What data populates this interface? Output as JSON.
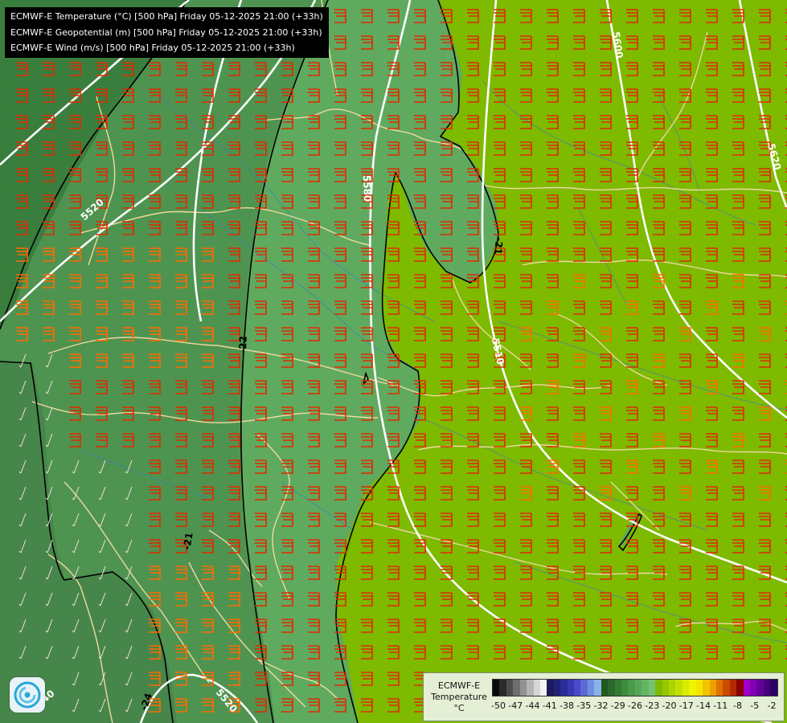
{
  "header": {
    "line1": "ECMWF-E Temperature (°C) [500 hPa] Friday 05-12-2025 21:00 (+33h)",
    "line2": "ECMWF-E Geopotential (m) [500 hPa] Friday 05-12-2025 21:00 (+33h)",
    "line3": "ECMWF-E Wind (m/s) [500 hPa] Friday 05-12-2025 21:00 (+33h)"
  },
  "legend": {
    "line1": "ECMWF-E",
    "line2": "Temperature",
    "unit": "°C",
    "colors": [
      "#0a0a0a",
      "#2b2b2b",
      "#4d4d4d",
      "#6f6f6f",
      "#929292",
      "#b4b4b4",
      "#d6d6d6",
      "#f2f2f2",
      "#1a1a5c",
      "#22227a",
      "#2c2c98",
      "#3838b2",
      "#4a4ac8",
      "#5a6ad6",
      "#6f8ee0",
      "#8ab4ea",
      "#1f5a1f",
      "#2a6a2a",
      "#347a34",
      "#3e8a3e",
      "#4a9a4a",
      "#56a856",
      "#63b563",
      "#72c272",
      "#7fba00",
      "#95c800",
      "#abd400",
      "#c2e000",
      "#d8ec00",
      "#eef500",
      "#f7e400",
      "#f2c400",
      "#ec9e00",
      "#e07000",
      "#cc4a00",
      "#b42a00",
      "#8c0000",
      "#a000c8",
      "#8200b4",
      "#64009a",
      "#46007e",
      "#2c0062"
    ],
    "ticks": [
      "-50",
      "-47",
      "-44",
      "-41",
      "-38",
      "-35",
      "-32",
      "-29",
      "-26",
      "-23",
      "-20",
      "-17",
      "-14",
      "-11",
      "-8",
      "-5",
      "-2"
    ]
  },
  "contour_labels": {
    "geopotential": [
      "5600",
      "5620",
      "5580",
      "5520",
      "5540",
      "5510",
      "5520"
    ],
    "temperature": [
      "-21",
      "-22",
      "-24",
      "-21"
    ]
  },
  "colors": {
    "zone_warm": "#7dba00",
    "zone_mid": "#5faa5f",
    "zone_cool": "#4e9450",
    "zone_cold": "#3a7e3e",
    "coast": "#f0d8a0",
    "rivers": "#3a78c8",
    "isohypse": "#ffffff",
    "isotherm": "#000000",
    "barb_strong": "#e02a00",
    "barb_medium": "#ff6a00",
    "barb_weak": "#f4dcdc"
  },
  "icons": {
    "logo": "ecmwf-logo-icon"
  }
}
